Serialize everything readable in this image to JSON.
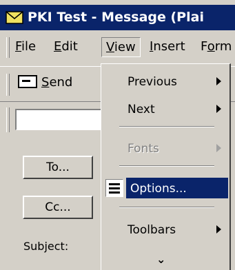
{
  "window": {
    "title": "PKI Test - Message (Plai"
  },
  "menubar": {
    "items": [
      {
        "label": "File",
        "key": "F"
      },
      {
        "label": "Edit",
        "key": ""
      },
      {
        "label": "View",
        "key": "V"
      },
      {
        "label": "Insert",
        "key": "I"
      },
      {
        "label": "Form",
        "key": "o"
      }
    ]
  },
  "toolbar": {
    "send_label": "Send",
    "send_key": "S",
    "send_rest": "end"
  },
  "header": {
    "to_label": "To...",
    "cc_label": "Cc...",
    "subject_label": "Subject:"
  },
  "view_menu": {
    "items": [
      {
        "label": "Previous",
        "state": "submenu"
      },
      {
        "label": "Next",
        "state": "submenu"
      },
      {
        "label": "Fonts",
        "state": "disabled-submenu"
      },
      {
        "label": "Options...",
        "state": "selected"
      },
      {
        "label": "Toolbars",
        "state": "submenu"
      }
    ],
    "expand_glyph": "⌄"
  },
  "colors": {
    "highlight": "#0a246a",
    "face": "#d4d0c8"
  }
}
